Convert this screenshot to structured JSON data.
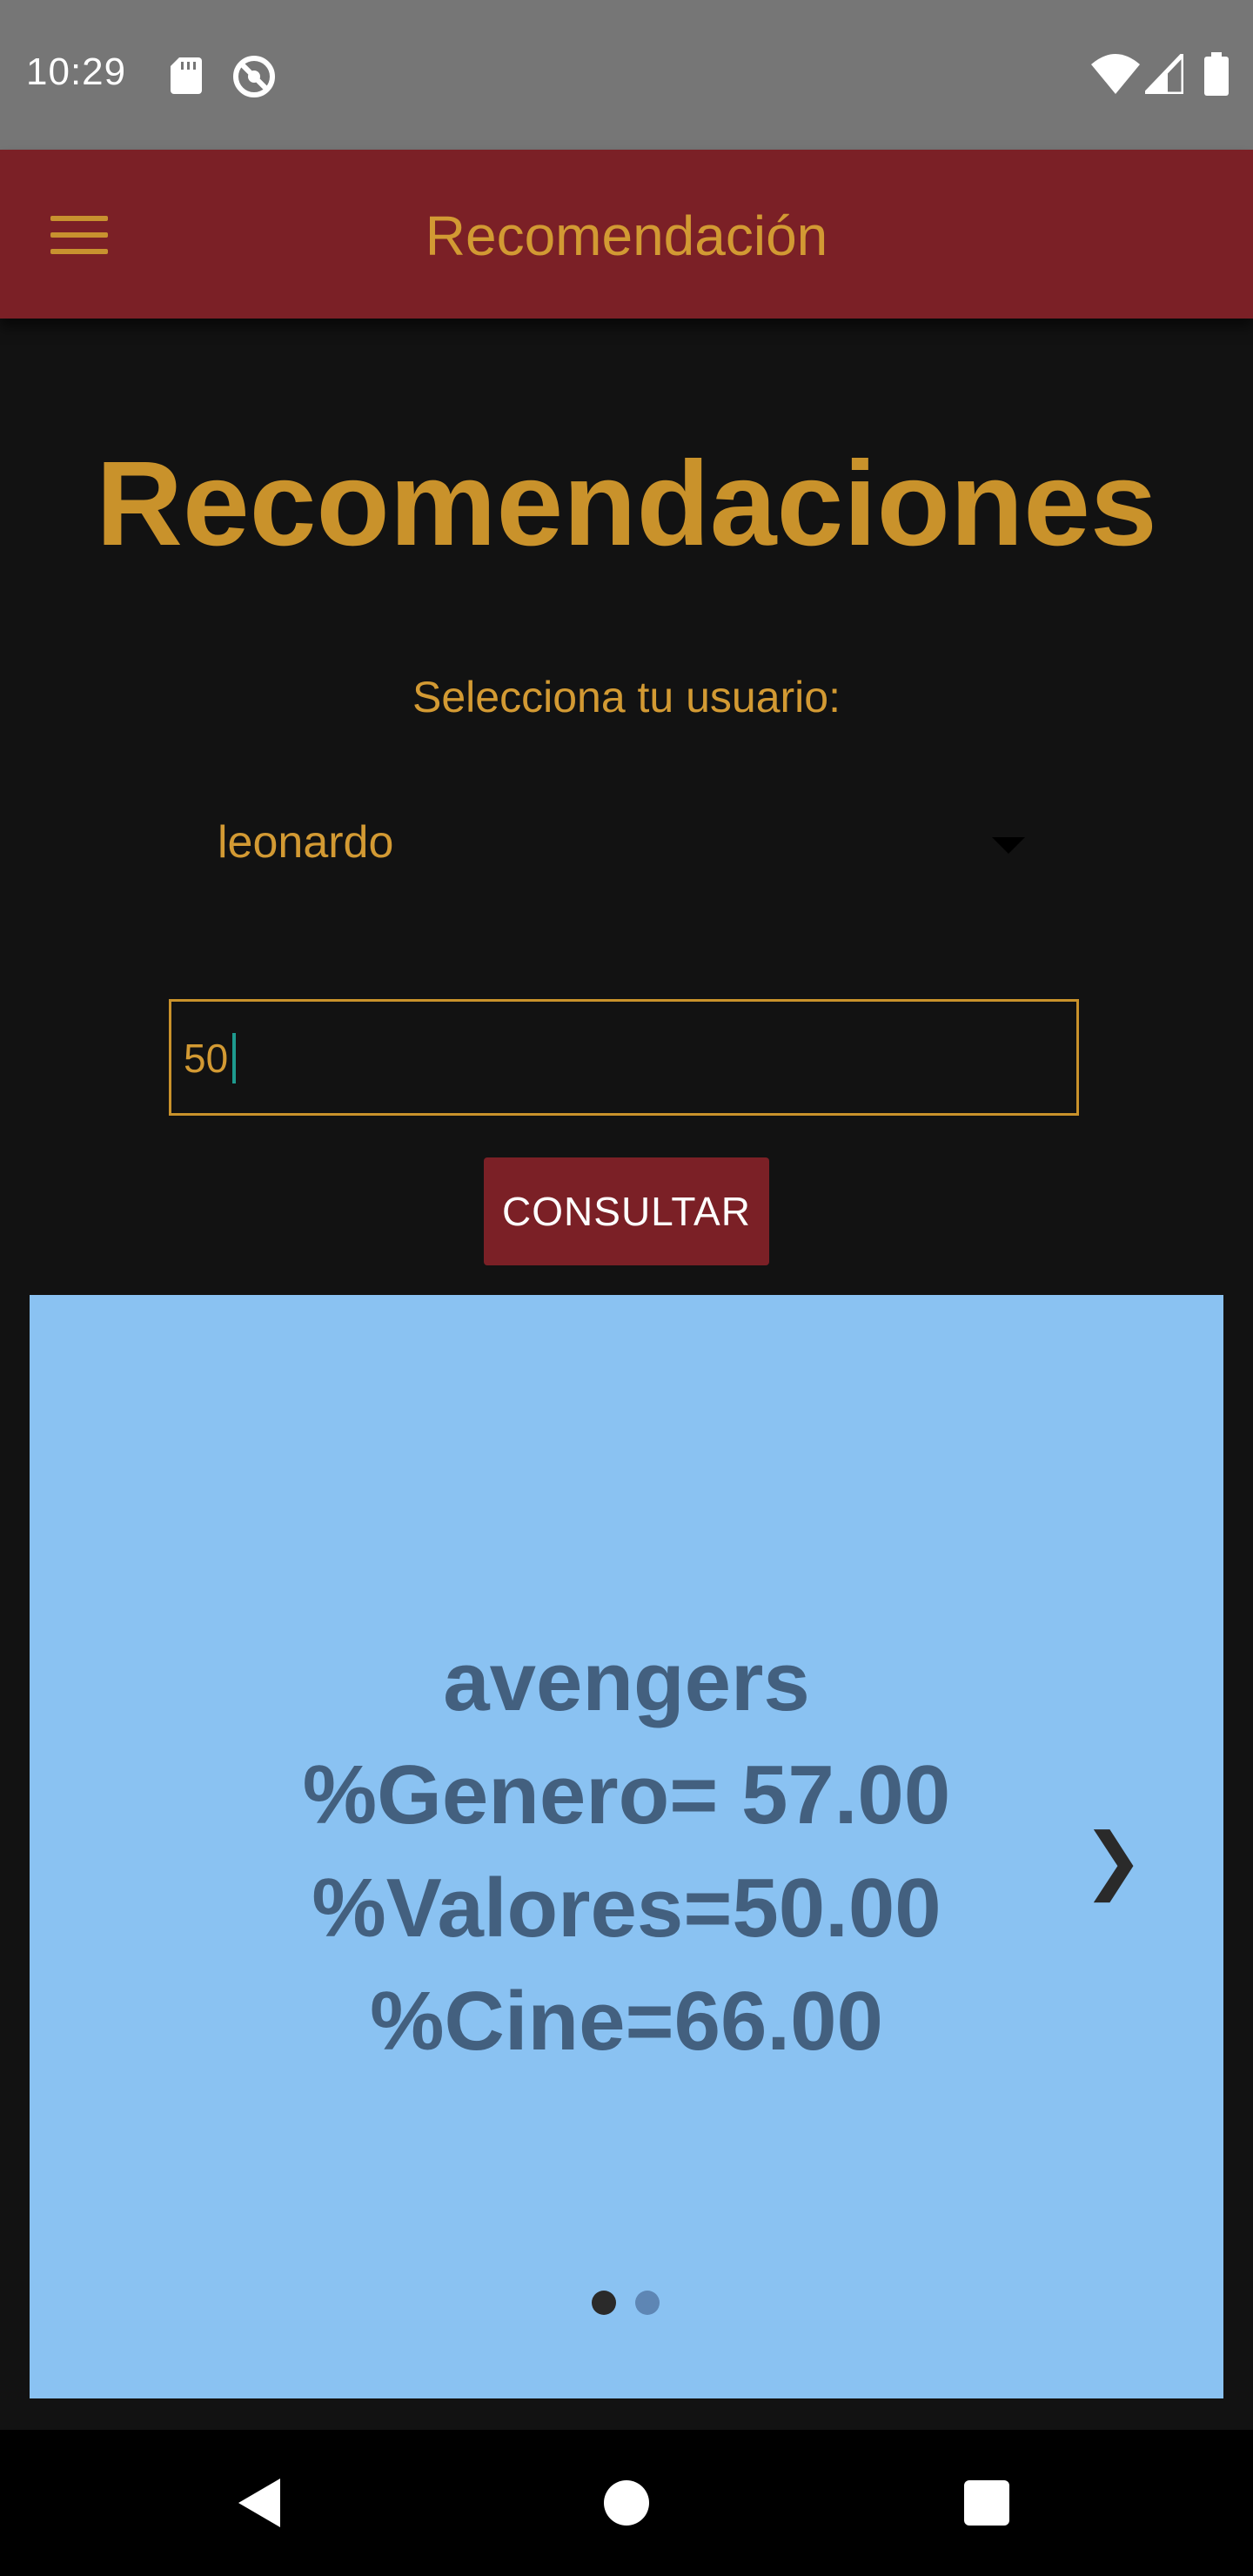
{
  "status_bar": {
    "time": "10:29",
    "icons": [
      "sd-card-icon",
      "do-not-disturb-icon",
      "wifi-icon",
      "signal-icon",
      "battery-icon"
    ]
  },
  "app_bar": {
    "title": "Recomendación",
    "menu_icon": "menu-icon"
  },
  "main": {
    "heading": "Recomendaciones",
    "select_label": "Selecciona tu usuario:",
    "user_select": {
      "selected": "leonardo"
    },
    "quantity_input": {
      "value": "50"
    },
    "consult_button": "CONSULTAR"
  },
  "carousel": {
    "slide": {
      "title": "avengers",
      "genero": "%Genero= 57.00",
      "valores": "%Valores=50.00",
      "cine": "%Cine=66.00"
    },
    "next_glyph": "❯",
    "page_count": 2,
    "active_page": 1
  },
  "colors": {
    "app_bar": "#7b2026",
    "accent": "#c9922b",
    "background": "#121212",
    "carousel": "#8ac2f2",
    "slide_text": "#43607f"
  },
  "nav_bar": {
    "icons": [
      "back-icon",
      "home-icon",
      "recents-icon"
    ]
  }
}
